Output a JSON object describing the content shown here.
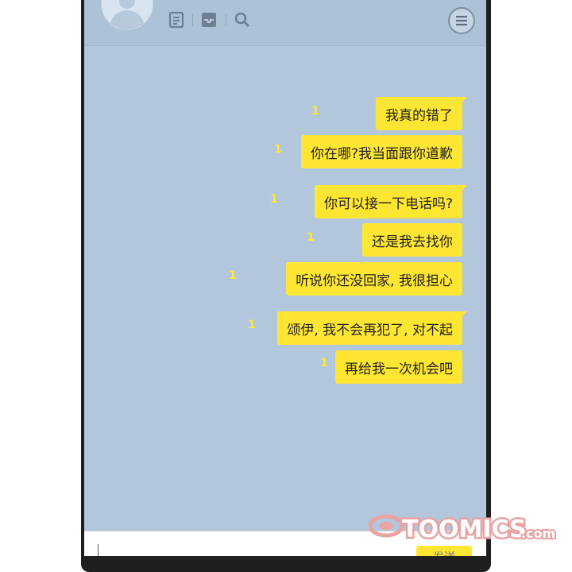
{
  "header": {
    "avatar_icon": "default-profile-avatar",
    "icons": [
      "document-icon",
      "inbox-icon",
      "search-icon",
      "hamburger-menu-icon"
    ]
  },
  "messages": [
    {
      "text": "我真的错了",
      "unread": "1",
      "tail": true
    },
    {
      "text": "你在哪?我当面跟你道歉",
      "unread": "1",
      "tail": false
    },
    {
      "text": "你可以接一下电话吗?",
      "unread": "1",
      "tail": true
    },
    {
      "text": "还是我去找你",
      "unread": "1",
      "tail": false
    },
    {
      "text": "听说你还没回家, 我很担心",
      "unread": "1",
      "tail": false
    },
    {
      "text": "颂伊, 我不会再犯了, 对不起",
      "unread": "1",
      "tail": true
    },
    {
      "text": "再给我一次机会吧",
      "unread": "1",
      "tail": false
    }
  ],
  "input": {
    "send_label": "发送"
  },
  "watermark": {
    "text": "TOOMICS.com"
  },
  "colors": {
    "chat_background": "#b2c7dc",
    "bubble": "#ffe633",
    "header": "#acc2d6",
    "watermark": "#e8a3a3"
  }
}
